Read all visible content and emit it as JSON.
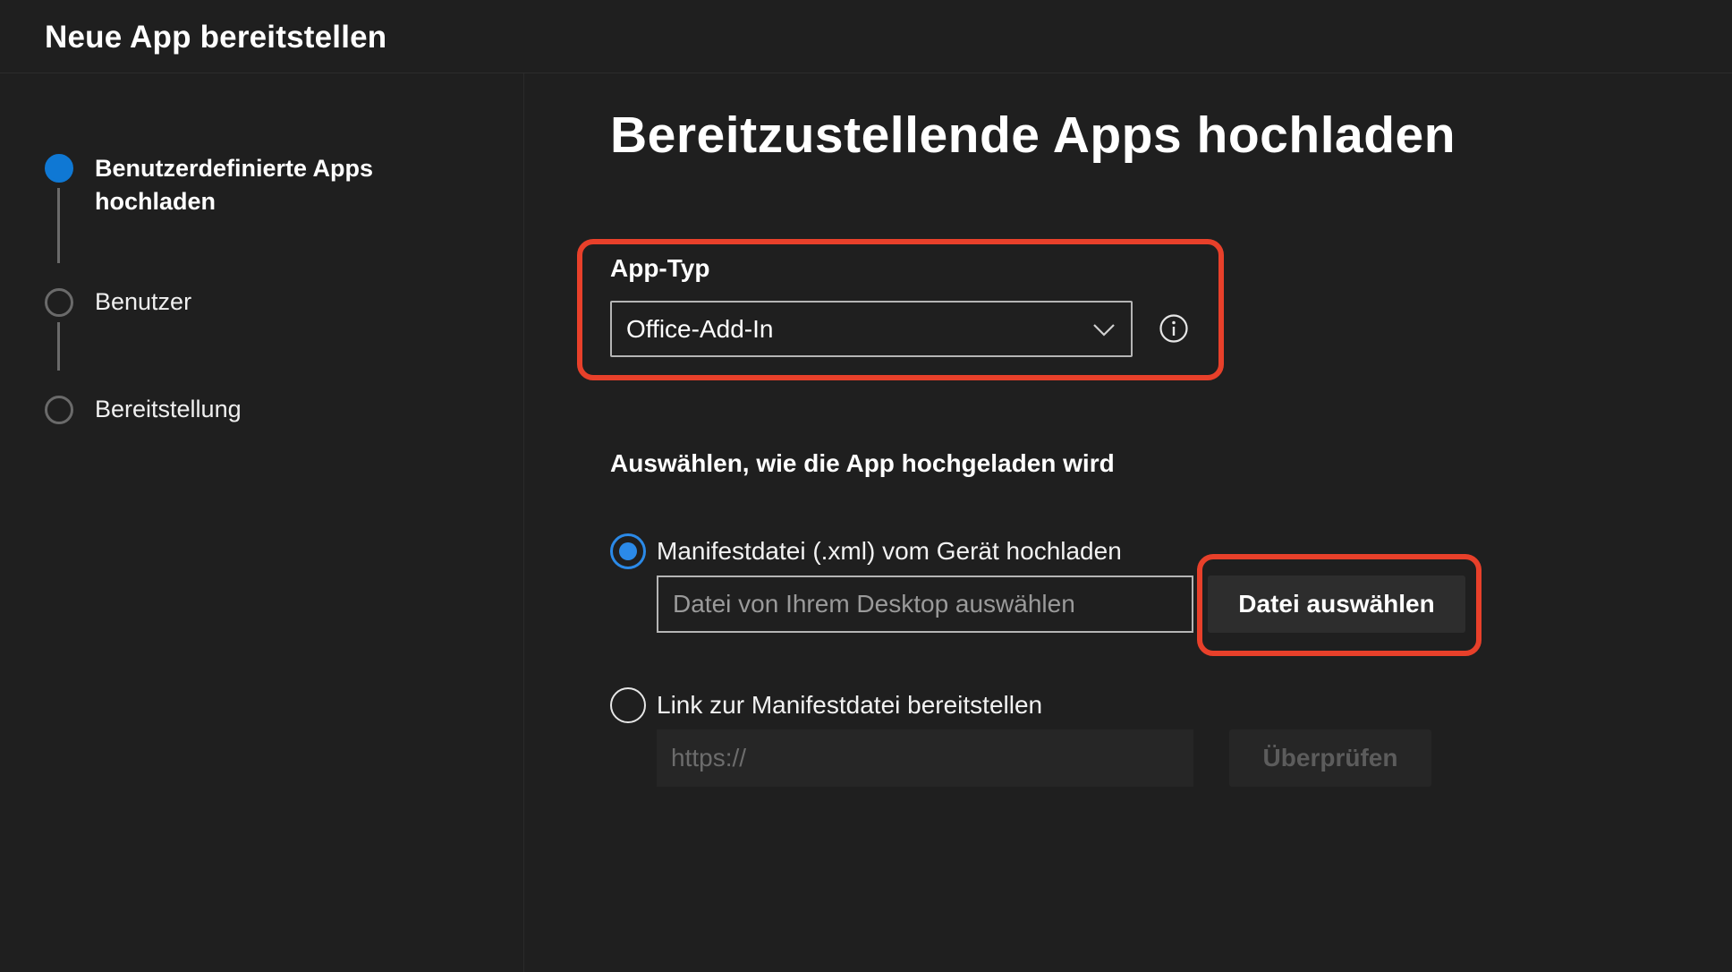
{
  "header": {
    "title": "Neue App bereitstellen"
  },
  "steps": [
    {
      "label": "Benutzerdefinierte Apps hochladen",
      "state": "active"
    },
    {
      "label": "Benutzer",
      "state": "pending"
    },
    {
      "label": "Bereitstellung",
      "state": "pending"
    }
  ],
  "main": {
    "title": "Bereitzustellende Apps hochladen",
    "app_type": {
      "label": "App-Typ",
      "selected": "Office-Add-In",
      "chevron_icon": "chevron-down-icon",
      "info_icon": "info-icon"
    },
    "upload_method": {
      "label": "Auswählen, wie die App hochgeladen wird",
      "options": [
        {
          "label": "Manifestdatei (.xml) vom Gerät hochladen",
          "checked": true,
          "input_placeholder": "Datei von Ihrem Desktop auswählen",
          "button_label": "Datei auswählen"
        },
        {
          "label": "Link zur Manifestdatei bereitstellen",
          "checked": false,
          "input_placeholder": "https://",
          "button_label": "Überprüfen"
        }
      ]
    }
  },
  "colors": {
    "accent": "#0f78d4",
    "highlight": "#e8402a",
    "background": "#1f1f1f"
  }
}
